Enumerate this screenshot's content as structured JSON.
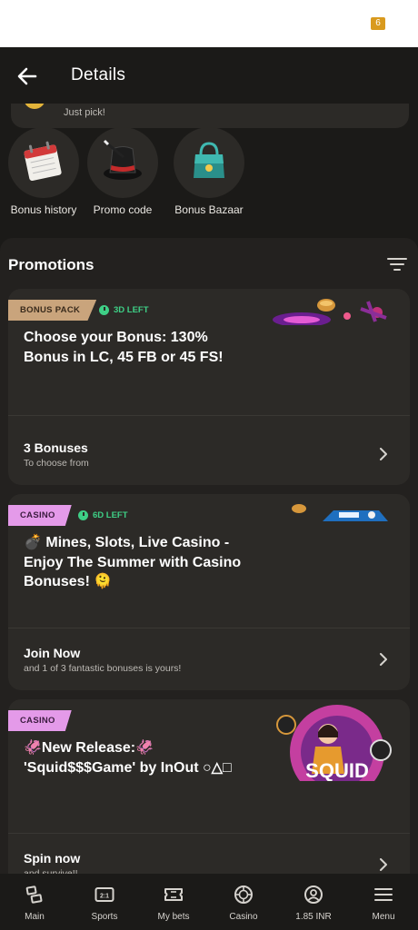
{
  "status_bar": {
    "badge": "6"
  },
  "header": {
    "title": "Details",
    "back_icon": "arrow-left-icon"
  },
  "top_card": {
    "text": "Just pick!"
  },
  "shortcuts": [
    {
      "label": "Bonus history",
      "icon": "calendar-icon"
    },
    {
      "label": "Promo code",
      "icon": "magic-hat-icon"
    },
    {
      "label": "Bonus Bazaar",
      "icon": "shopping-bag-icon"
    }
  ],
  "promotions": {
    "title": "Promotions",
    "filter_icon": "filter-icon",
    "cards": [
      {
        "tag": "BONUS PACK",
        "timer": "3D LEFT",
        "heading": "Choose your Bonus: 130% Bonus in LC, 45 FB or 45 FS!",
        "footer_title": "3 Bonuses",
        "footer_sub": "To choose from"
      },
      {
        "tag": "CASINO",
        "timer": "6D LEFT",
        "heading": "💣 Mines, Slots, Live Casino - Enjoy The Summer with Casino Bonuses! 🫠",
        "footer_title": "Join Now",
        "footer_sub": "and 1 of 3 fantastic bonuses is yours!"
      },
      {
        "tag": "CASINO",
        "heading": "🦑New Release:🦑 'Squid$$$Game' by InOut ○△□",
        "art_text": "SQUID",
        "footer_title": "Spin now",
        "footer_sub": "and survive!!"
      }
    ]
  },
  "bottom_nav": [
    {
      "label": "Main",
      "icon": "main-icon"
    },
    {
      "label": "Sports",
      "icon": "scoreboard-icon"
    },
    {
      "label": "My bets",
      "icon": "ticket-icon"
    },
    {
      "label": "Casino",
      "icon": "casino-chip-icon"
    },
    {
      "label": "1.85 INR",
      "icon": "account-icon"
    },
    {
      "label": "Menu",
      "icon": "hamburger-menu-icon"
    }
  ],
  "colors": {
    "background": "#1b1a18",
    "card": "#2c2a27",
    "timer_green": "#3ecf86",
    "bonus_tag": "#c9a47c",
    "casino_tag": "#e49ae9"
  }
}
